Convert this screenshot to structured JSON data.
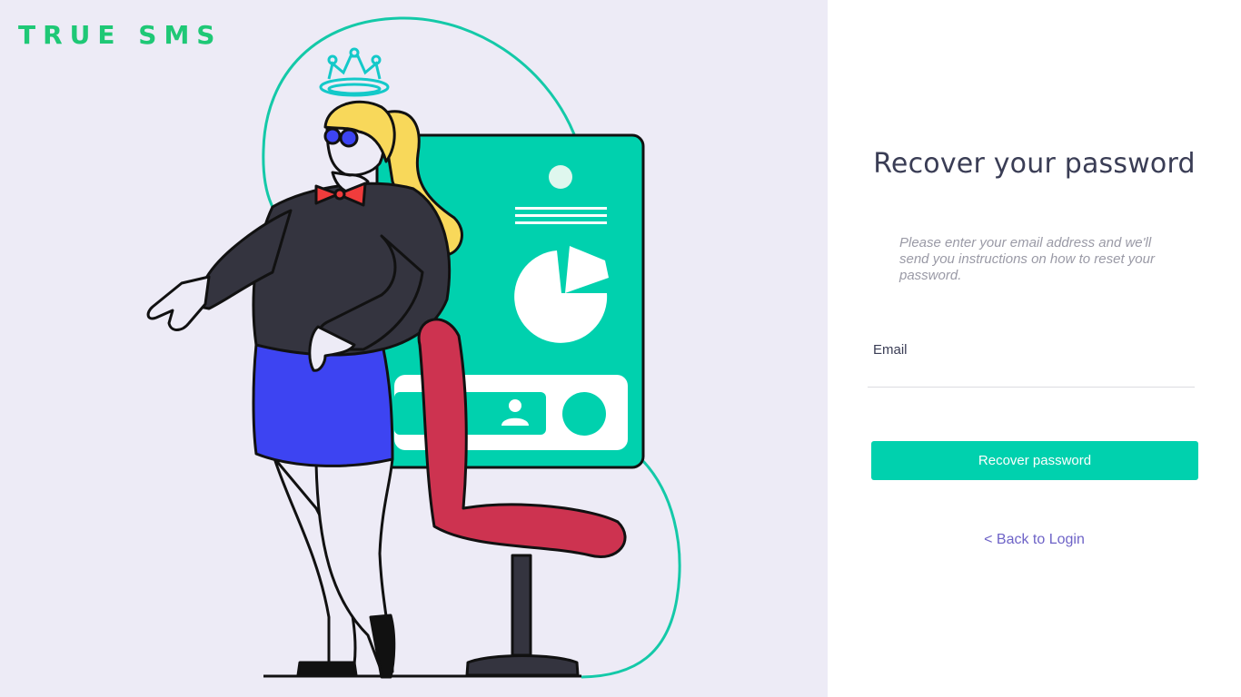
{
  "brand": {
    "name": "TRUE SMS"
  },
  "form": {
    "title": "Recover your password",
    "subtitle": "Please enter your email address and we'll send you instructions on how to reset your password.",
    "email_label": "Email",
    "email_value": "",
    "submit_label": "Recover password",
    "back_link": "< Back to Login"
  },
  "colors": {
    "brand_green": "#1fc876",
    "accent_teal": "#00d1ae",
    "link_purple": "#6e63c7",
    "left_background": "#edebf6"
  },
  "illustration": {
    "icons": [
      "woman-pointing",
      "halo-crown-icon",
      "dashboard-card",
      "pie-chart-icon",
      "user-icon",
      "office-chair"
    ]
  }
}
